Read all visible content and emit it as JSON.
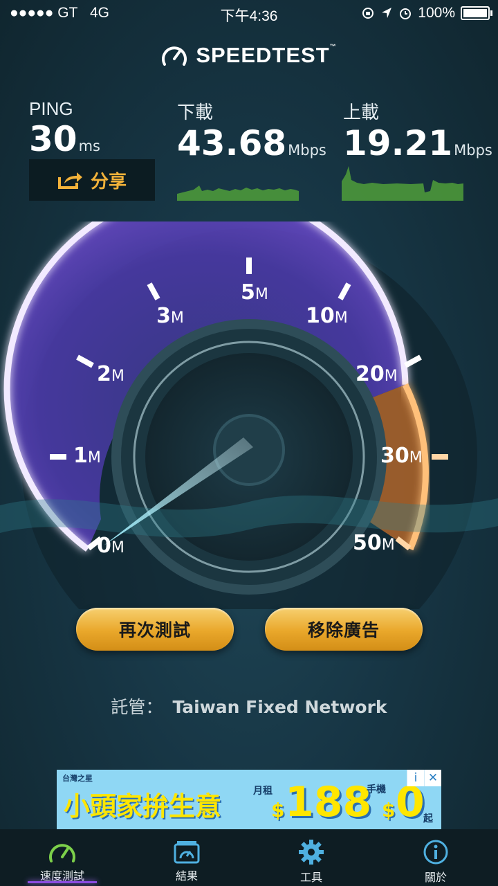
{
  "status_bar": {
    "signal": "●●●●● GT",
    "network": "4G",
    "time": "下午4:36",
    "battery": "100%",
    "icons": [
      "rotation-lock-icon",
      "location-arrow-icon",
      "alarm-icon",
      "battery-icon"
    ]
  },
  "app": {
    "title": "SPEEDTEST",
    "trademark": "™"
  },
  "metrics": {
    "ping": {
      "label": "PING",
      "value": "30",
      "unit": "ms"
    },
    "download": {
      "label": "下載",
      "value": "43.68",
      "unit": "Mbps"
    },
    "upload": {
      "label": "上載",
      "value": "19.21",
      "unit": "Mbps"
    }
  },
  "share": {
    "label": "分享"
  },
  "gauge": {
    "ticks": [
      {
        "n": "0",
        "u": "M"
      },
      {
        "n": "1",
        "u": "M"
      },
      {
        "n": "2",
        "u": "M"
      },
      {
        "n": "3",
        "u": "M"
      },
      {
        "n": "5",
        "u": "M"
      },
      {
        "n": "10",
        "u": "M"
      },
      {
        "n": "20",
        "u": "M"
      },
      {
        "n": "30",
        "u": "M"
      },
      {
        "n": "50",
        "u": "M"
      }
    ]
  },
  "buttons": {
    "retest": "再次測試",
    "remove_ads": "移除廣告"
  },
  "host": {
    "label": "託管：",
    "value": "Taiwan Fixed Network"
  },
  "ad": {
    "brand": "台灣之星",
    "headline": "小頭家拚生意",
    "rent_label": "月租",
    "rent_currency": "$",
    "rent_price": "188",
    "phone_label": "手機",
    "phone_currency": "$",
    "phone_price": "0",
    "suffix": "起",
    "info": "i",
    "close": "✕"
  },
  "tabs": [
    {
      "label": "速度測試",
      "icon": "speedometer-icon",
      "active": true
    },
    {
      "label": "結果",
      "icon": "results-box-icon",
      "active": false
    },
    {
      "label": "工具",
      "icon": "gear-icon",
      "active": false
    },
    {
      "label": "關於",
      "icon": "info-icon",
      "active": false
    }
  ],
  "colors": {
    "accent_orange": "#f3b23a",
    "gauge_purple": "#6e49c8",
    "gauge_orange": "#f0913a",
    "sparkline_green": "#5dbb3f"
  }
}
